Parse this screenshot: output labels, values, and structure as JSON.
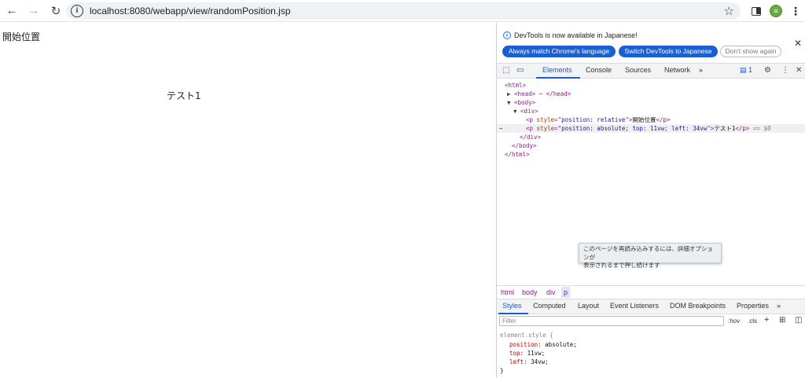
{
  "browser": {
    "url": "localhost:8080/webapp/view/randomPosition.jsp",
    "back_icon": "←",
    "forward_icon": "→",
    "reload_icon": "↻",
    "info_icon": "i",
    "star_icon": "☆",
    "avatar_letter": "≡",
    "menu_icon": "⋮"
  },
  "page": {
    "p1": "開始位置",
    "p2": "テスト1"
  },
  "devtools": {
    "infobar": {
      "icon": "i",
      "message": "DevTools is now available in Japanese!",
      "btn_match": "Always match Chrome's language",
      "btn_switch": "Switch DevTools to Japanese",
      "btn_dismiss": "Don't show again",
      "close": "✕"
    },
    "tabs": {
      "elements": "Elements",
      "console": "Console",
      "sources": "Sources",
      "network": "Network",
      "more": "»",
      "issues_count": "1",
      "settings_icon": "⚙",
      "menu_icon": "⋮",
      "close_icon": "✕",
      "inspect_icon": "⬚",
      "device_icon": "▭"
    },
    "dom": {
      "html_open": "<html>",
      "head_tri": "▶",
      "head_open": "<head>",
      "head_ellipsis": "⋯",
      "head_close": "</head>",
      "body_tri": "▼",
      "body_open": "<body>",
      "div_tri": "▼",
      "div_open": "<div>",
      "p1_open_a": "<p ",
      "p1_attr": "style",
      "p1_eq": "=\"",
      "p1_val": "position: relative",
      "p1_close_a": "\">",
      "p1_text": "開始位置",
      "p1_close": "</p>",
      "p2_dots": "⋯",
      "p2_open_a": "<p ",
      "p2_attr": "style",
      "p2_eq": "=\"",
      "p2_val": "position: absolute; top: 11vw; left: 34vw",
      "p2_close_a": "\">",
      "p2_text": "テスト1",
      "p2_close": "</p>",
      "p2_marker": " == $0",
      "div_close": "</div>",
      "body_close": "</body>",
      "html_close": "</html>"
    },
    "tooltip": {
      "line1": "このページを再読み込みするには、詳細オプションが",
      "line2": "表示されるまで押し続けます"
    },
    "breadcrumb": [
      "html",
      "body",
      "div",
      "p"
    ],
    "styles_tabs": {
      "styles": "Styles",
      "computed": "Computed",
      "layout": "Layout",
      "event_listeners": "Event Listeners",
      "dom_breakpoints": "DOM Breakpoints",
      "properties": "Properties",
      "more": "»"
    },
    "filter": {
      "placeholder": "Filter",
      "hov": ":hov",
      "cls": ".cls",
      "plus": "+",
      "paint_icon": "⊞",
      "sidebar_icon": "◫"
    },
    "rule": {
      "selector": "element.style {",
      "props": [
        {
          "name": "position",
          "value": "absolute;"
        },
        {
          "name": "top",
          "value": "11vw;"
        },
        {
          "name": "left",
          "value": "34vw;"
        }
      ],
      "close": "}"
    }
  }
}
